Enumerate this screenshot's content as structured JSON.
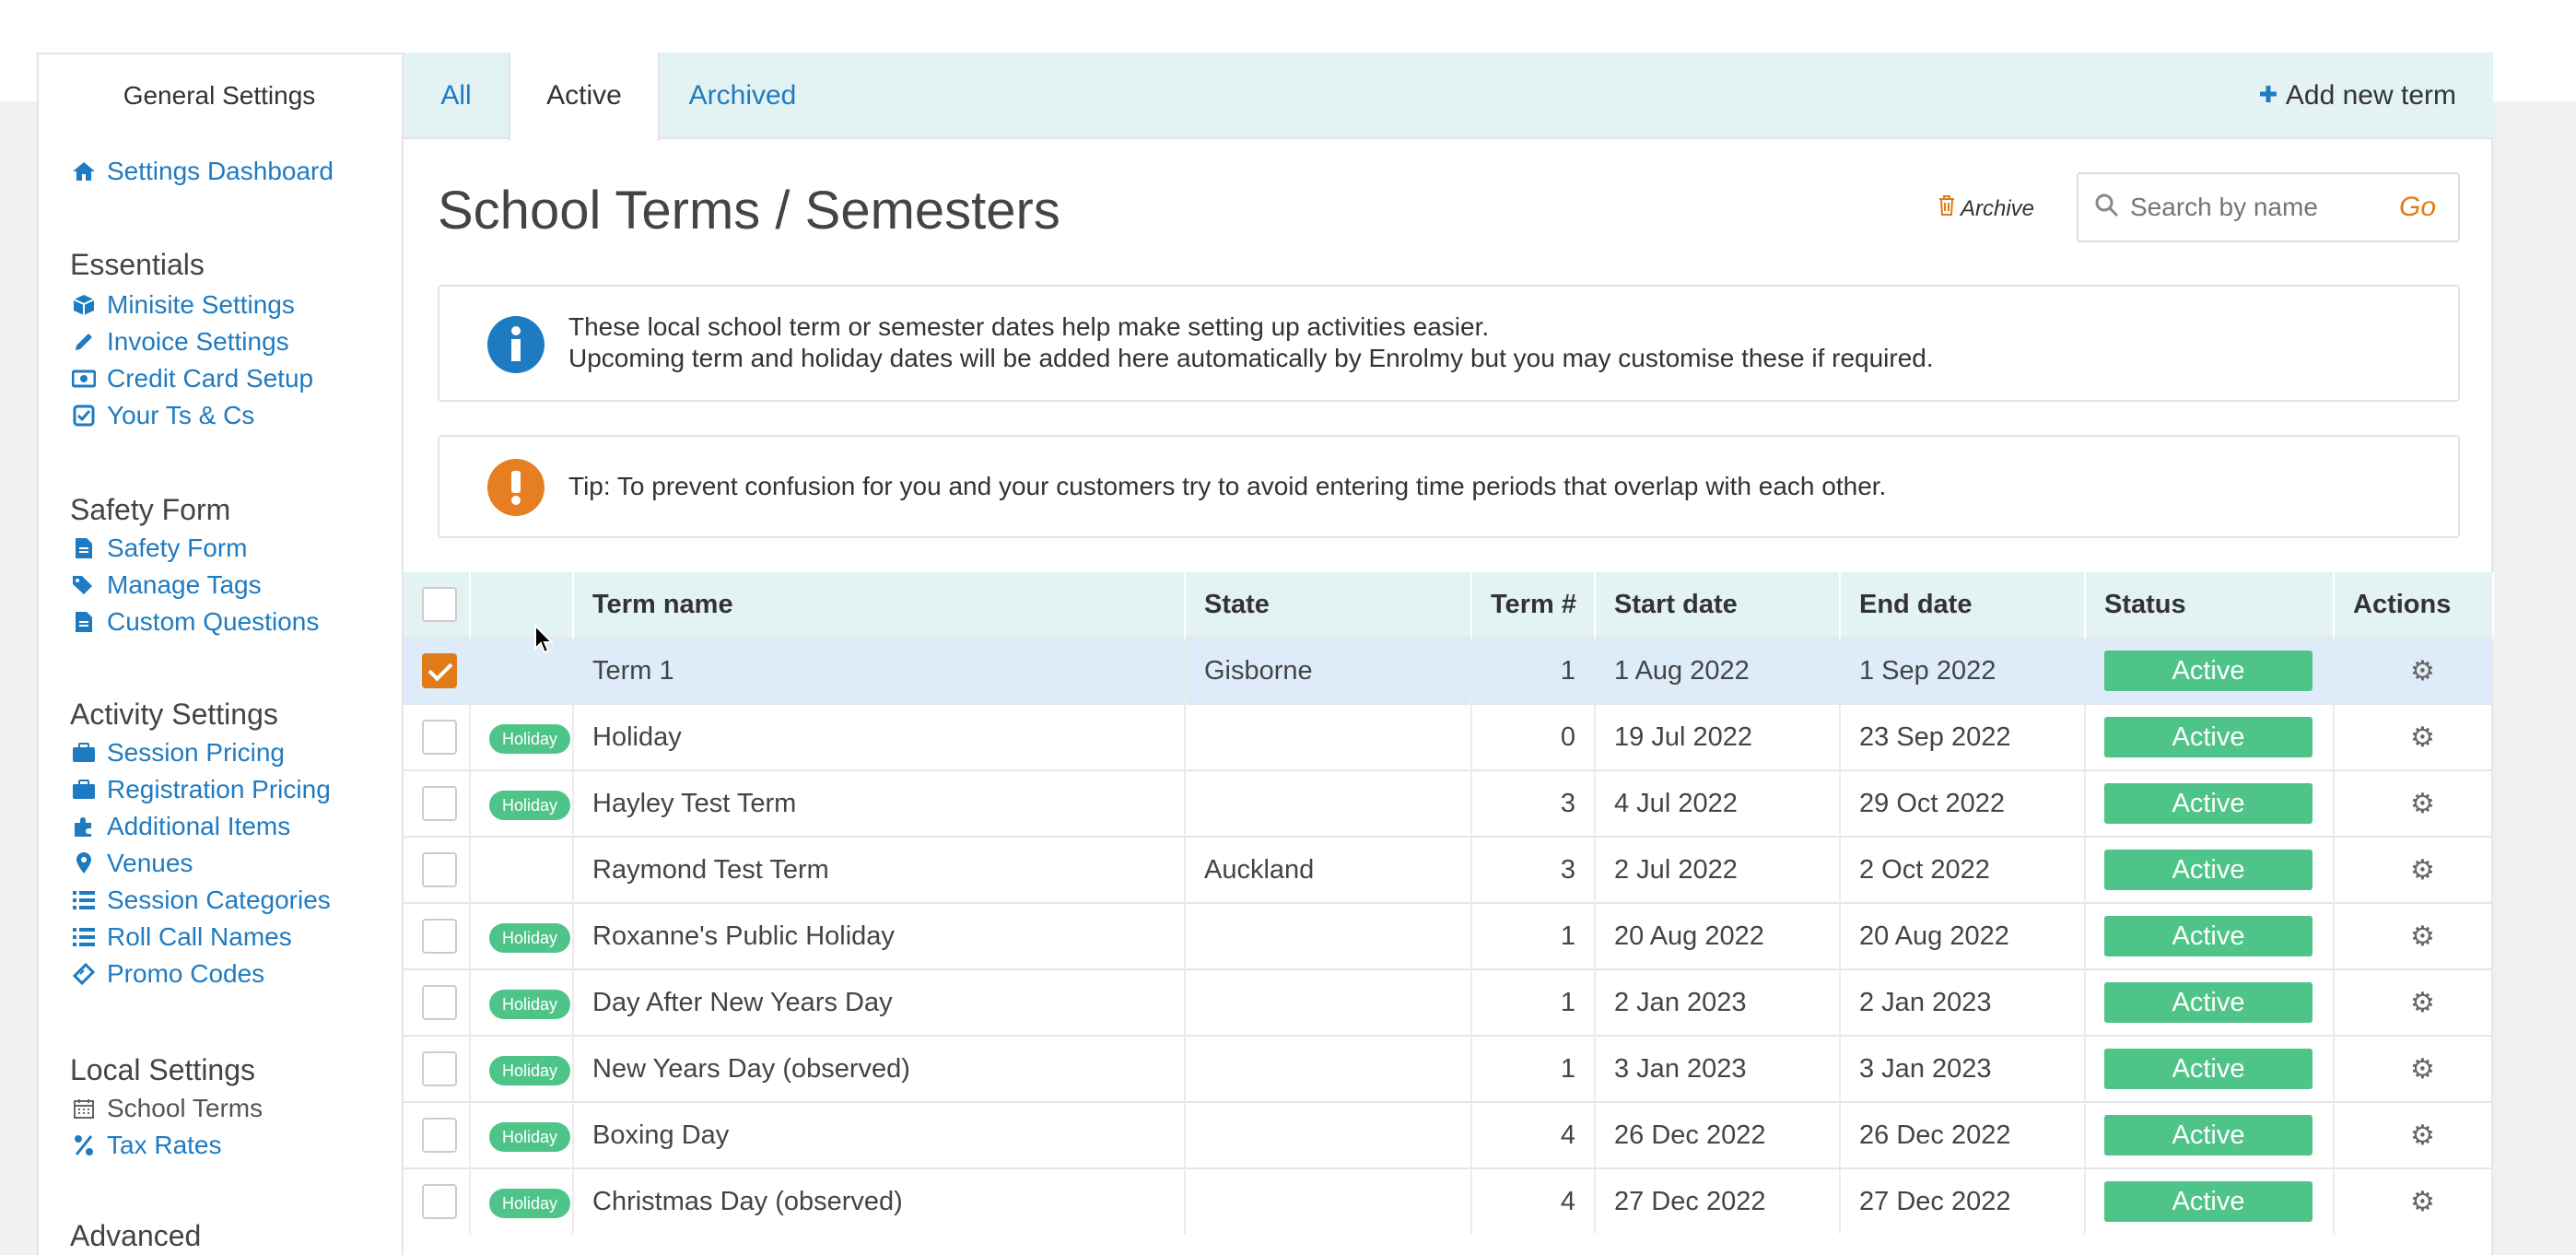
{
  "sidebar": {
    "title": "General Settings",
    "dashboard": "Settings Dashboard",
    "sections": {
      "essentials": {
        "heading": "Essentials",
        "items": [
          "Minisite Settings",
          "Invoice Settings",
          "Credit Card Setup",
          "Your Ts & Cs"
        ]
      },
      "safety": {
        "heading": "Safety Form",
        "items": [
          "Safety Form",
          "Manage Tags",
          "Custom Questions"
        ]
      },
      "activity": {
        "heading": "Activity Settings",
        "items": [
          "Session Pricing",
          "Registration Pricing",
          "Additional Items",
          "Venues",
          "Session Categories",
          "Roll Call Names",
          "Promo Codes"
        ]
      },
      "local": {
        "heading": "Local Settings",
        "items": [
          "School Terms",
          "Tax Rates"
        ]
      },
      "advanced": {
        "heading": "Advanced"
      }
    }
  },
  "tabs": [
    "All",
    "Active",
    "Archived"
  ],
  "add_term": "Add new term",
  "page_title": "School Terms / Semesters",
  "archive_label": "Archive",
  "search": {
    "placeholder": "Search by name",
    "go": "Go"
  },
  "info": {
    "line1": "These local school term or semester dates help make setting up activities easier.",
    "line2": "Upcoming term and holiday dates will be added here automatically by Enrolmy but you may customise these if required."
  },
  "tip": "Tip: To prevent confusion for you and your customers try to avoid entering time periods that overlap with each other.",
  "table": {
    "headers": [
      "Term name",
      "State",
      "Term #",
      "Start date",
      "End date",
      "Status",
      "Actions"
    ],
    "rows": [
      {
        "tag": "",
        "name": "Term 1",
        "state": "Gisborne",
        "term": "1",
        "start": "1 Aug 2022",
        "end": "1 Sep 2022",
        "status": "Active"
      },
      {
        "tag": "Holiday",
        "name": "Holiday",
        "state": "",
        "term": "0",
        "start": "19 Jul 2022",
        "end": "23 Sep 2022",
        "status": "Active"
      },
      {
        "tag": "Holiday",
        "name": "Hayley Test Term",
        "state": "",
        "term": "3",
        "start": "4 Jul 2022",
        "end": "29 Oct 2022",
        "status": "Active"
      },
      {
        "tag": "",
        "name": "Raymond Test Term",
        "state": "Auckland",
        "term": "3",
        "start": "2 Jul 2022",
        "end": "2 Oct 2022",
        "status": "Active"
      },
      {
        "tag": "Holiday",
        "name": "Roxanne's Public Holiday",
        "state": "",
        "term": "1",
        "start": "20 Aug 2022",
        "end": "20 Aug 2022",
        "status": "Active"
      },
      {
        "tag": "Holiday",
        "name": "Day After New Years Day",
        "state": "",
        "term": "1",
        "start": "2 Jan 2023",
        "end": "2 Jan 2023",
        "status": "Active"
      },
      {
        "tag": "Holiday",
        "name": "New Years Day (observed)",
        "state": "",
        "term": "1",
        "start": "3 Jan 2023",
        "end": "3 Jan 2023",
        "status": "Active"
      },
      {
        "tag": "Holiday",
        "name": "Boxing Day",
        "state": "",
        "term": "4",
        "start": "26 Dec 2022",
        "end": "26 Dec 2022",
        "status": "Active"
      },
      {
        "tag": "Holiday",
        "name": "Christmas Day (observed)",
        "state": "",
        "term": "4",
        "start": "27 Dec 2022",
        "end": "27 Dec 2022",
        "status": "Active"
      }
    ]
  },
  "colors": {
    "link": "#1f7bc1",
    "active_green": "#4fc489",
    "accent_orange": "#e07b1a",
    "info_blue": "#1f7bc1",
    "tab_bg": "#e3f2f2"
  }
}
